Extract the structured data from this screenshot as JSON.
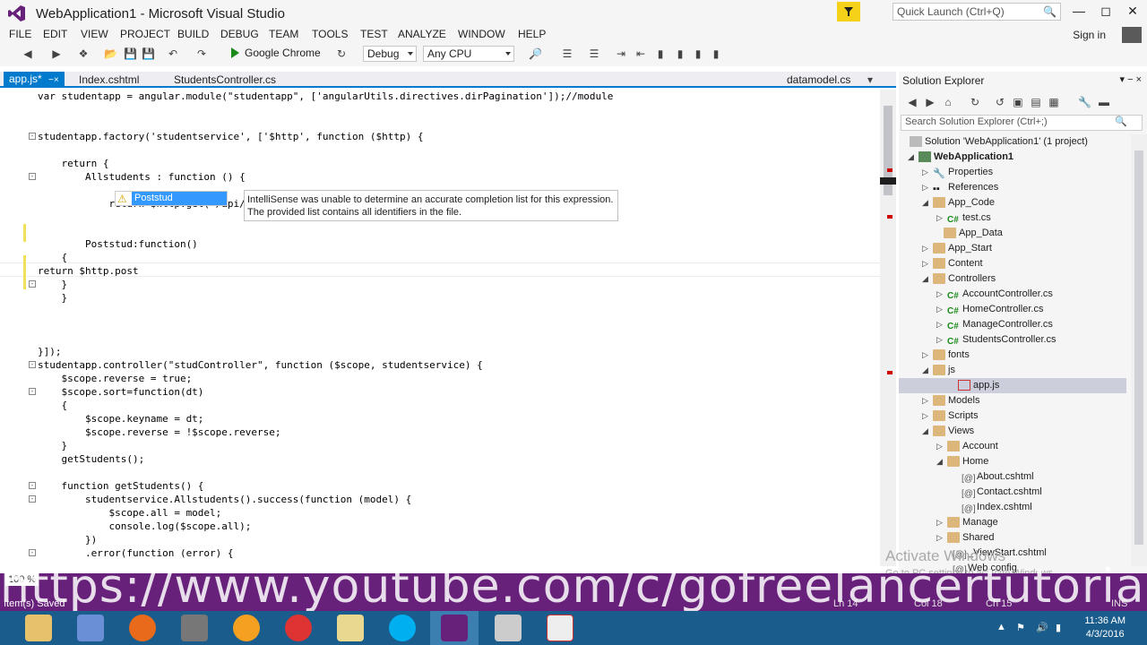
{
  "window": {
    "title": "WebApplication1 - Microsoft Visual Studio",
    "quick_launch": "Quick Launch (Ctrl+Q)"
  },
  "menu": {
    "items": [
      "FILE",
      "EDIT",
      "VIEW",
      "PROJECT",
      "BUILD",
      "DEBUG",
      "TEAM",
      "TOOLS",
      "TEST",
      "ANALYZE",
      "WINDOW",
      "HELP"
    ],
    "sign_in": "Sign in"
  },
  "toolbar": {
    "run_label": "Google Chrome",
    "config": "Debug",
    "platform": "Any CPU"
  },
  "tabs": {
    "items": [
      "app.js*",
      "Index.cshtml",
      "StudentsController.cs"
    ],
    "right": "datamodel.cs"
  },
  "editor": {
    "lines": [
      "var studentapp = angular.module(\"studentapp\", ['angularUtils.directives.dirPagination']);//module",
      "studentapp.factory('studentservice', ['$http', function ($http) {",
      "    return {",
      "        Allstudents : function () {",
      "            return $http.get('/api/students/all');",
      "        Poststud:function()",
      "    {",
      "return $http.post",
      "    }",
      "    }",
      "}]);",
      "studentapp.controller(\"studController\", function ($scope, studentservice) {",
      "    $scope.reverse = true;",
      "    $scope.sort=function(dt)",
      "    {",
      "        $scope.keyname = dt;",
      "        $scope.reverse = !$scope.reverse;",
      "    }",
      "    getStudents();",
      "    function getStudents() {",
      "        studentservice.Allstudents().success(function (model) {",
      "            $scope.all = model;",
      "            console.log($scope.all);",
      "        })",
      "        .error(function (error) {"
    ],
    "intellisense_item": "Poststud",
    "intellisense_tip_1": "IntelliSense was unable to determine an accurate completion list for this expression.",
    "intellisense_tip_2": "The provided list contains all identifiers in the file."
  },
  "solution_explorer": {
    "title": "Solution Explorer",
    "search_placeholder": "Search Solution Explorer (Ctrl+;)",
    "items": [
      "Solution 'WebApplication1' (1 project)",
      "WebApplication1",
      "Properties",
      "References",
      "App_Code",
      "test.cs",
      "App_Data",
      "App_Start",
      "Content",
      "Controllers",
      "AccountController.cs",
      "HomeController.cs",
      "ManageController.cs",
      "StudentsController.cs",
      "fonts",
      "js",
      "app.js",
      "Models",
      "Scripts",
      "Views",
      "Account",
      "Home",
      "About.cshtml",
      "Contact.cshtml",
      "Index.cshtml",
      "Manage",
      "Shared",
      "_ViewStart.cshtml",
      "Web.config"
    ]
  },
  "status": {
    "zoom": "100 %",
    "ready": "Item(s) Saved",
    "ln": "Ln 14",
    "col": "Col 18",
    "ch": "Ch 15",
    "ins": "INS"
  },
  "overlay": {
    "url": "https://www.youtube.com/c/gofreelancertutorial",
    "activate": "Activate Windows",
    "activate_sub": "Go to PC settings to activate Windows."
  },
  "taskbar": {
    "time": "11:36 AM",
    "date": "4/3/2016"
  },
  "colors": {
    "accent": "#007acc",
    "status_bar": "#68217a",
    "taskbar": "#1a5d8c"
  }
}
